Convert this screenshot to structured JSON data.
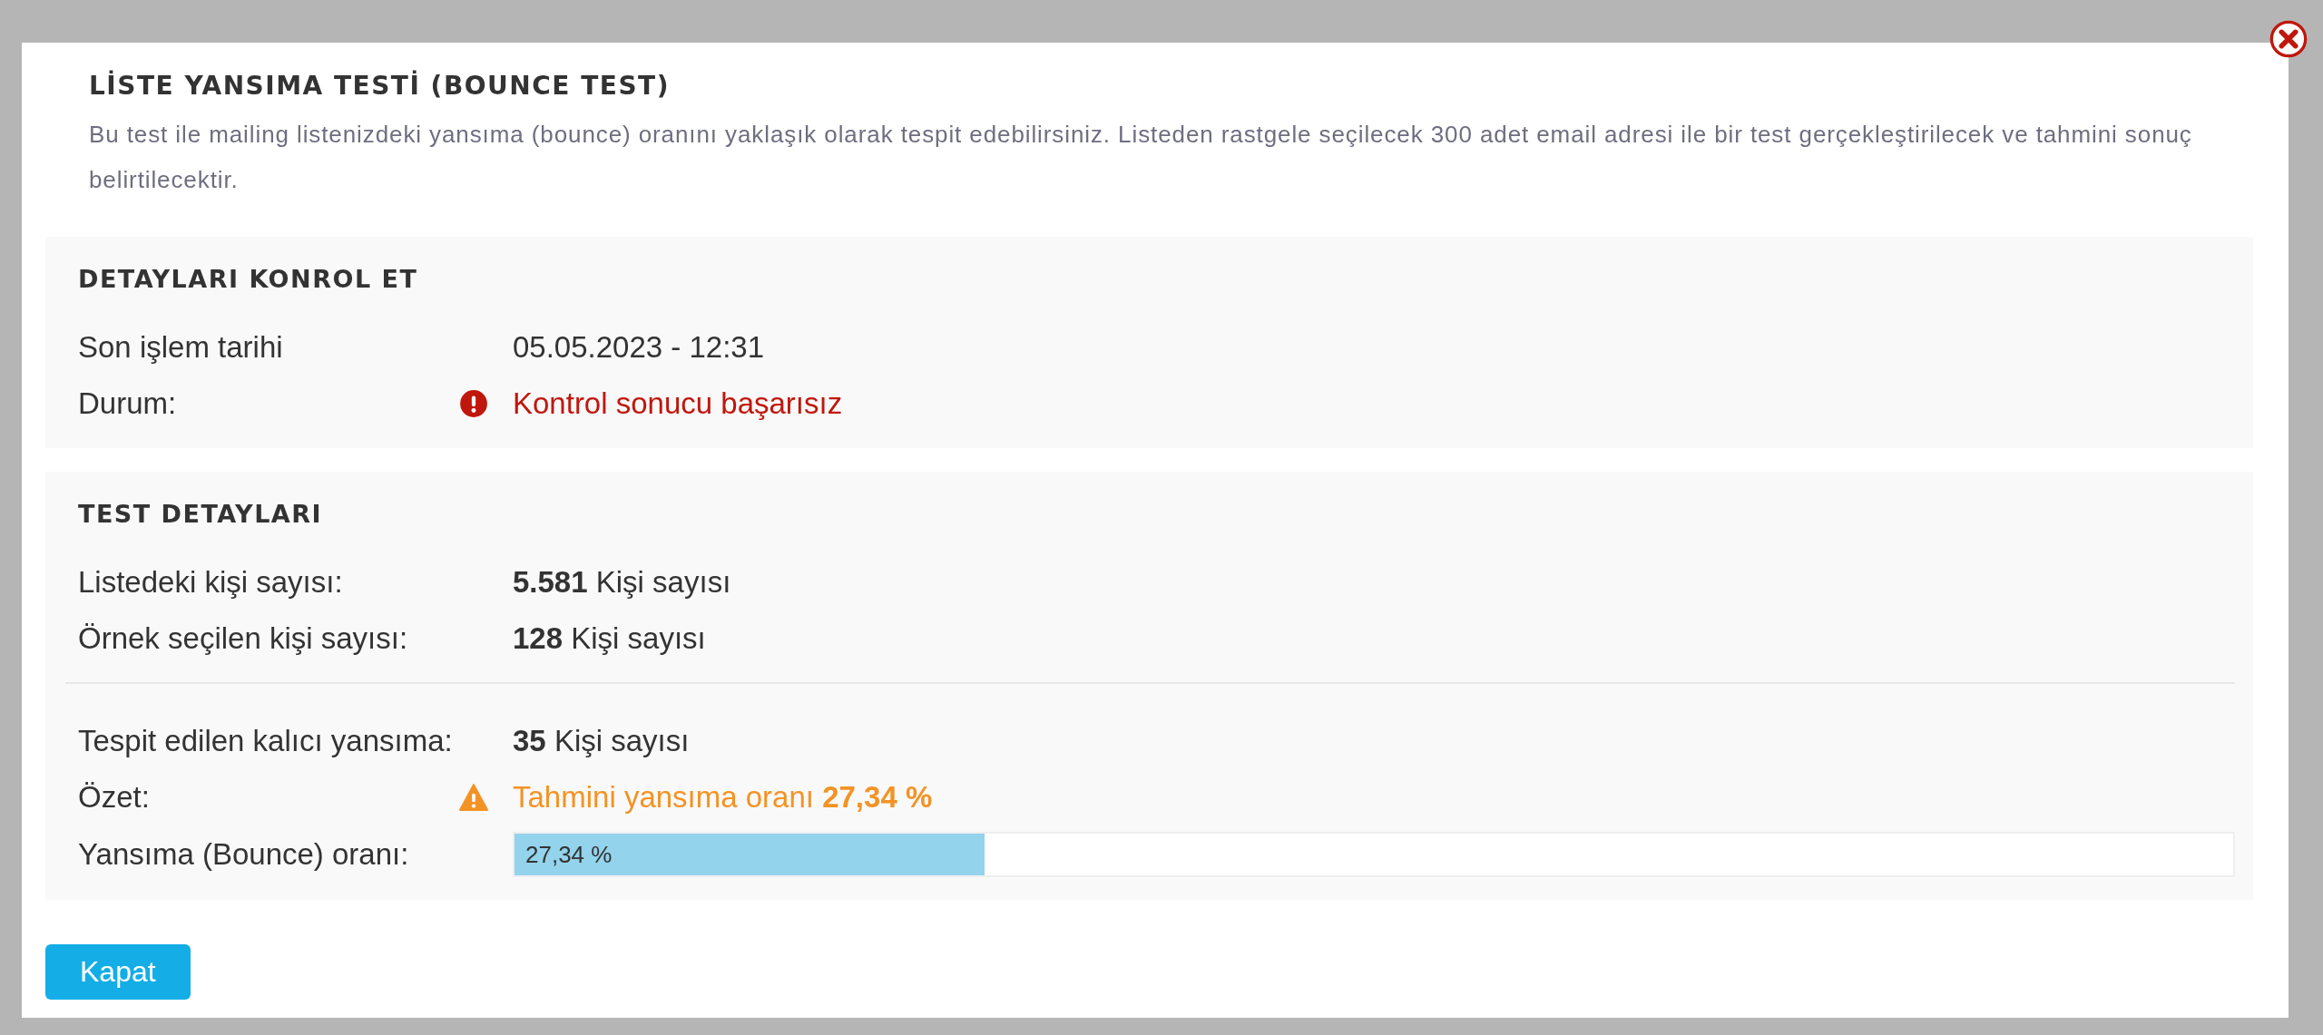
{
  "dialog": {
    "title": "LİSTE YANSIMA TESTİ (BOUNCE TEST)",
    "description": "Bu test ile mailing listenizdeki yansıma (bounce) oranını yaklaşık olarak tespit edebilirsiniz. Listeden rastgele seçilecek 300 adet email adresi ile bir test gerçekleştirilecek ve tahmini sonuç belirtilecektir.",
    "sections": [
      {
        "title": "DETAYLARI KONROL ET",
        "groups": [
          [
            {
              "kind": "text",
              "label": "Son işlem tarihi",
              "value": "05.05.2023 - 12:31"
            },
            {
              "kind": "error",
              "label": "Durum:",
              "value": "Kontrol sonucu başarısız"
            }
          ]
        ]
      },
      {
        "title": "TEST DETAYLARI",
        "groups": [
          [
            {
              "kind": "text",
              "label": "Listedeki kişi sayısı:",
              "value": "**5.581** Kişi sayısı"
            },
            {
              "kind": "text",
              "label": "Örnek seçilen kişi sayısı:",
              "value": "**128** Kişi sayısı"
            }
          ],
          [
            {
              "kind": "text",
              "label": "Tespit edilen kalıcı yansıma:",
              "value": "**35** Kişi sayısı"
            },
            {
              "kind": "warning",
              "label": "Özet:",
              "value": "Tahmini yansıma oranı **27,34 %**"
            },
            {
              "kind": "progress",
              "label": "Yansıma (Bounce) oranı:",
              "level": 0.2734,
              "reading": "27,34 %"
            }
          ]
        ]
      }
    ],
    "close_button": "Kapat"
  }
}
